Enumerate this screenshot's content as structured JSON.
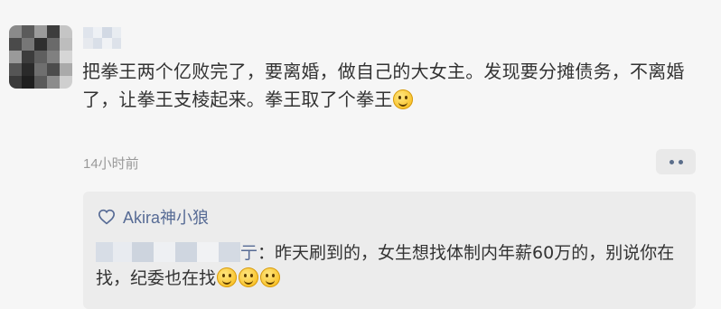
{
  "post": {
    "text": "把拳王两个亿败完了，要离婚，做自己的大女主。发现要分摊债务，不离婚了，让拳王支棱起来。拳王取了个拳王",
    "time": "14小时前"
  },
  "icons": {
    "avatar": "blurred-avatar",
    "smiley": "smiley-face",
    "more": "more-dots-icon",
    "like": "heart-outline-icon"
  },
  "likes": {
    "names": "Akira神小狼"
  },
  "comment": {
    "suffix_name": "亍",
    "text": "：昨天刷到的，女生想找体制内年薪60万的，别说你在找，纪委也在找"
  },
  "colors": {
    "link": "#576b95",
    "background": "#f6f6f6",
    "comment_bg": "#ececec"
  }
}
